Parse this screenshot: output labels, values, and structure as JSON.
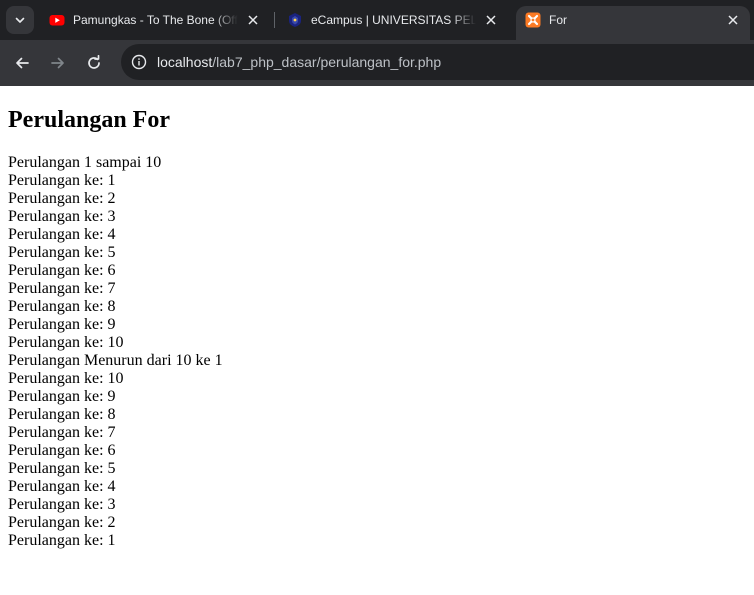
{
  "browser": {
    "tabs": [
      {
        "title": "Pamungkas - To The Bone (Official",
        "icon": "youtube-icon",
        "active": false
      },
      {
        "title": "eCampus | UNIVERSITAS PELITA",
        "icon": "campus-logo-icon",
        "active": false
      },
      {
        "title": "For",
        "icon": "xampp-icon",
        "active": true
      }
    ],
    "url_host": "localhost",
    "url_path": "/lab7_php_dasar/perulangan_for.php"
  },
  "page": {
    "heading": "Perulangan For",
    "lines": [
      "Perulangan 1 sampai 10",
      "Perulangan ke: 1",
      "Perulangan ke: 2",
      "Perulangan ke: 3",
      "Perulangan ke: 4",
      "Perulangan ke: 5",
      "Perulangan ke: 6",
      "Perulangan ke: 7",
      "Perulangan ke: 8",
      "Perulangan ke: 9",
      "Perulangan ke: 10",
      "Perulangan Menurun dari 10 ke 1",
      "Perulangan ke: 10",
      "Perulangan ke: 9",
      "Perulangan ke: 8",
      "Perulangan ke: 7",
      "Perulangan ke: 6",
      "Perulangan ke: 5",
      "Perulangan ke: 4",
      "Perulangan ke: 3",
      "Perulangan ke: 2",
      "Perulangan ke: 1"
    ]
  },
  "colors": {
    "tabstrip": "#202124",
    "toolbar": "#35363a",
    "youtube_red": "#ff0000",
    "xampp_orange": "#fb7a24"
  }
}
